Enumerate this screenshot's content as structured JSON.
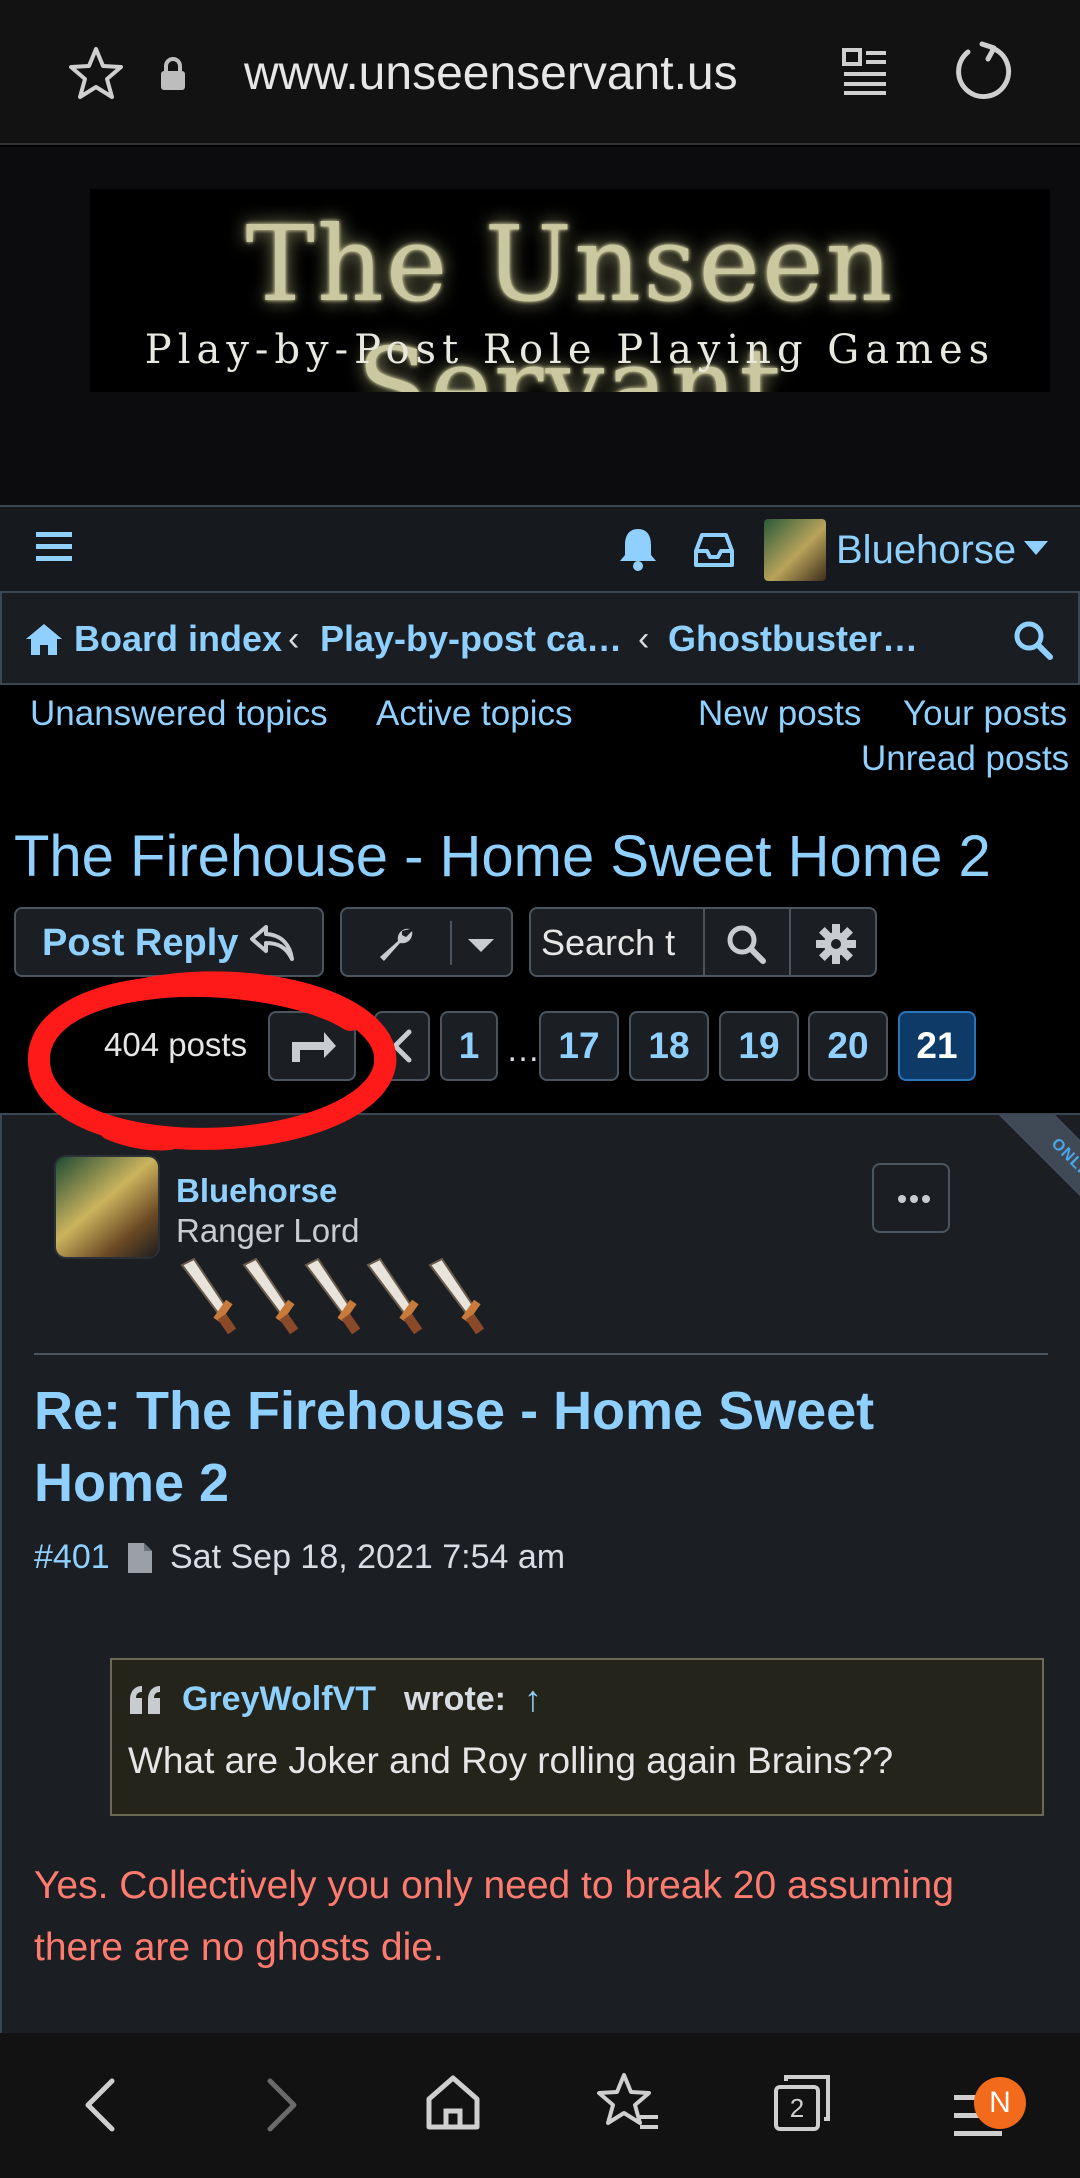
{
  "browser": {
    "url": "www.unseenservant.us",
    "tab_count": "2",
    "notification_badge": "N"
  },
  "banner": {
    "title": "The Unseen Servant",
    "subtitle": "Play-by-Post Role Playing Games"
  },
  "navbar": {
    "username": "Bluehorse"
  },
  "breadcrumbs": [
    {
      "label": "Board index"
    },
    {
      "label": "Play-by-post ca…"
    },
    {
      "label": "Ghostbuster…"
    }
  ],
  "quick_links": {
    "unanswered": "Unanswered topics",
    "active": "Active topics",
    "new_posts": "New posts",
    "your_posts": "Your posts",
    "unread_posts": "Unread posts"
  },
  "topic": {
    "title": "The Firehouse - Home Sweet Home 2"
  },
  "actions": {
    "post_reply": "Post Reply",
    "search_placeholder": "Search t"
  },
  "pagination": {
    "post_count": "404 posts",
    "pages": [
      "1",
      "17",
      "18",
      "19",
      "20",
      "21"
    ],
    "ellipsis": "…",
    "current": "21"
  },
  "post": {
    "online_label": "ONLINE",
    "author": "Bluehorse",
    "rank": "Ranger Lord",
    "subject": "Re: The Firehouse - Home Sweet Home 2",
    "number": "#401",
    "date": "Sat Sep 18, 2021 7:54 am",
    "quote": {
      "author": "GreyWolfVT",
      "wrote": "wrote:",
      "arrow": "↑",
      "text": "What are Joker and Roy rolling again Brains??"
    },
    "body": "Yes. Collectively you only need to break 20 assuming there are no ghosts die."
  },
  "colors": {
    "link": "#8fd0ff",
    "body_text_red": "#ff7b6e",
    "active_page": "#0d3a66",
    "annotation_circle": "#ff1a1a",
    "badge": "#f26a1b"
  }
}
